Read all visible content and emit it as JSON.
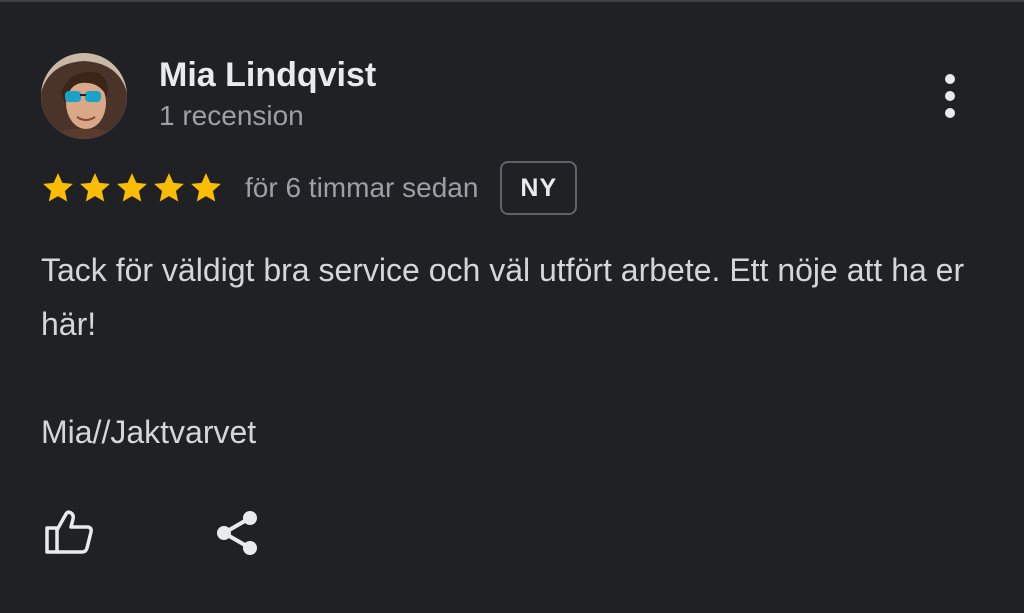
{
  "review": {
    "author_name": "Mia Lindqvist",
    "author_subtitle": "1 recension",
    "rating": 5,
    "rating_max": 5,
    "time_ago": "för 6 timmar sedan",
    "badge": "NY",
    "text_line": "Tack för väldigt bra service och väl utfört arbete. Ett nöje att ha er här!",
    "signature": "Mia//Jaktvarvet"
  },
  "icons": {
    "menu": "more-vert-icon",
    "star": "star-icon",
    "like": "thumbs-up-icon",
    "share": "share-icon"
  },
  "colors": {
    "background": "#202124",
    "star": "#fbbc04",
    "primary_text": "#e8eaed",
    "secondary_text": "#9aa0a6",
    "badge_border": "#5f6368"
  }
}
